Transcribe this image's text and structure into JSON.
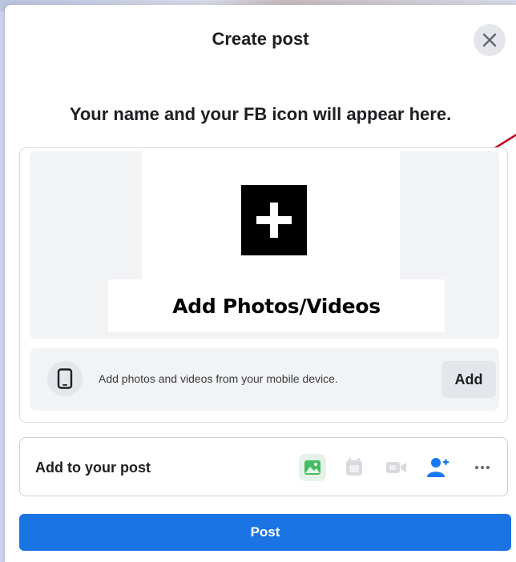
{
  "dialog": {
    "title": "Create post",
    "author_placeholder": "Your name and your FB icon will appear here."
  },
  "media": {
    "dropzone_label": "Add Photos/Videos",
    "mobile_hint": "Add photos and videos from your mobile device.",
    "add_label": "Add"
  },
  "add_to_post": {
    "label": "Add to your post",
    "tools": [
      "photo-video-icon",
      "gif-icon",
      "live-video-icon",
      "tag-people-icon",
      "more-options-icon"
    ]
  },
  "post_button_label": "Post",
  "colors": {
    "primary": "#1b74e4",
    "photo_green": "#45bd62",
    "tag_blue": "#1877f2",
    "arrow_red": "#c0001a"
  }
}
